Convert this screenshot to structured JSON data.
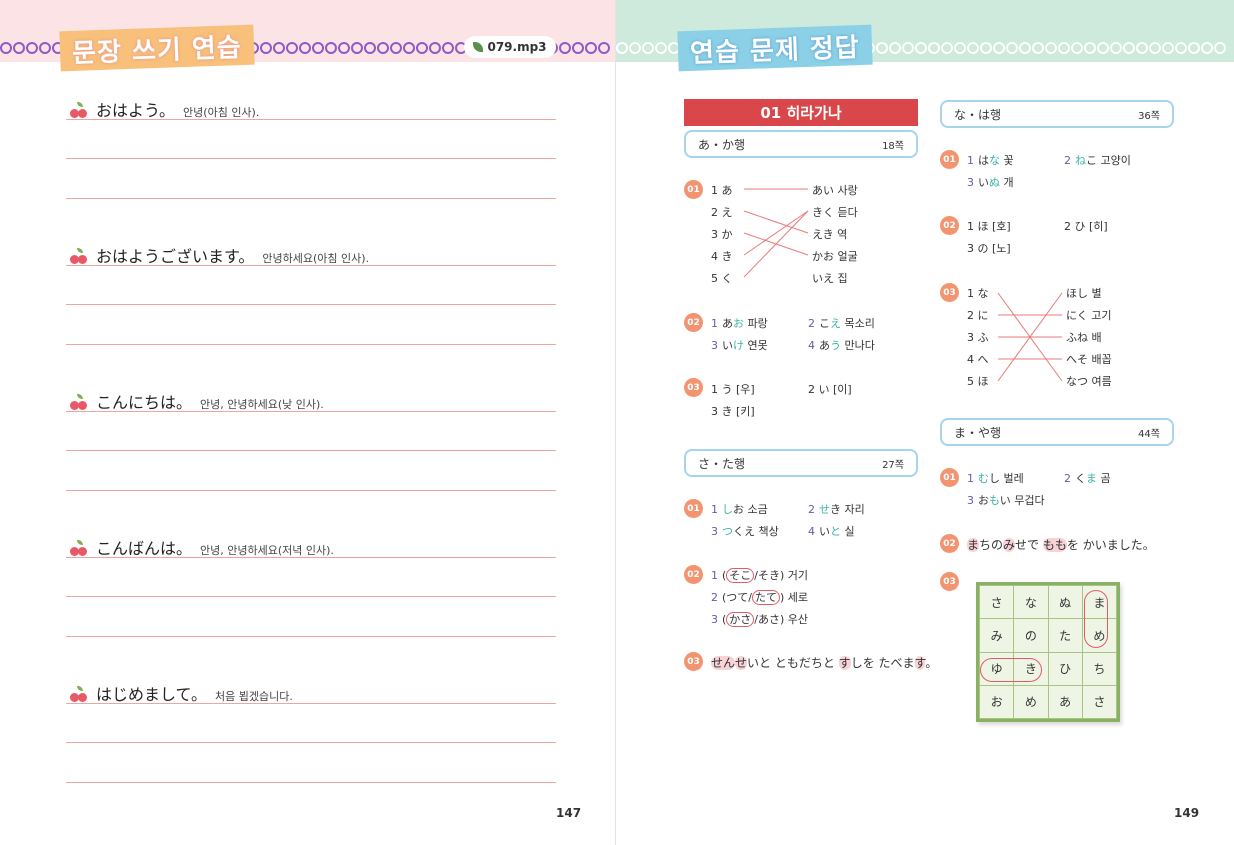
{
  "left": {
    "title": "문장 쓰기 연습",
    "audio": "079.mp3",
    "page_number": "147",
    "sentences": [
      {
        "jp": "おはよう。",
        "kr": "안녕(아침 인사)."
      },
      {
        "jp": "おはようございます。",
        "kr": "안녕하세요(아침 인사)."
      },
      {
        "jp": "こんにちは。",
        "kr": "안녕, 안녕하세요(낮 인사)."
      },
      {
        "jp": "こんばんは。",
        "kr": "안녕, 안녕하세요(저녁 인사)."
      },
      {
        "jp": "はじめまして。",
        "kr": "처음 뵙겠습니다."
      }
    ]
  },
  "right": {
    "title": "연습 문제 정답",
    "page_number": "149",
    "unit_title": "01 히라가나",
    "sections": {
      "a_ka": {
        "label": "あ・か행",
        "page": "18쪽"
      },
      "sa_ta": {
        "label": "さ・た행",
        "page": "27쪽"
      },
      "na_ha": {
        "label": "な・は행",
        "page": "36쪽"
      },
      "ma_ya": {
        "label": "ま・や행",
        "page": "44쪽"
      }
    },
    "numbers": [
      "01",
      "02",
      "03"
    ],
    "aka_q1_left": [
      "1 あ",
      "2 え",
      "3 か",
      "4 き",
      "5 く"
    ],
    "aka_q1_right": [
      "あい 사랑",
      "きく 듣다",
      "えき 역",
      "かお 얼굴",
      "いえ 집"
    ],
    "aka_q2": [
      "1 あお 파랑",
      "2 こえ 목소리",
      "3 いけ 연못",
      "4 あう 만나다"
    ],
    "aka_q3": [
      "1 う [우]",
      "2 い [이]",
      "3 き [키]"
    ],
    "sata_q1": [
      "1 しお 소금",
      "2 せき 자리",
      "3 つくえ 책상",
      "4 いと 실"
    ],
    "sata_q2": [
      "1 (そこ/そき) 거기",
      "2 (つて/たて) 세로",
      "3 (かさ/あさ) 우산"
    ],
    "sata_q3": "せんせいと ともだちと すしを たべます。",
    "naha_q1": [
      "1 はな 꽃",
      "2 ねこ 고양이",
      "3 いぬ 개"
    ],
    "naha_q2": [
      "1 ほ [호]",
      "2 ひ [히]",
      "3 の [노]"
    ],
    "naha_q3_left": [
      "1 な",
      "2 に",
      "3 ふ",
      "4 へ",
      "5 ほ"
    ],
    "naha_q3_right": [
      "ほし 별",
      "にく 고기",
      "ふね 배",
      "へそ 배꼽",
      "なつ 여름"
    ],
    "maya_q1": [
      "1 むし 벌레",
      "2 くま 곰",
      "3 おもい 무겁다"
    ],
    "maya_q2": "まちの みせで ももを かいました。",
    "maya_grid": [
      [
        "さ",
        "な",
        "ぬ",
        "ま"
      ],
      [
        "み",
        "の",
        "た",
        "め"
      ],
      [
        "ゆ",
        "き",
        "ひ",
        "ち"
      ],
      [
        "お",
        "め",
        "あ",
        "さ"
      ]
    ]
  },
  "colors": {
    "left_band": "#fbe3e6",
    "right_band": "#cdeadc",
    "accent_red": "#d9474a",
    "number_badge": "#f29470",
    "highlight_teal": "#3cb4a6"
  }
}
